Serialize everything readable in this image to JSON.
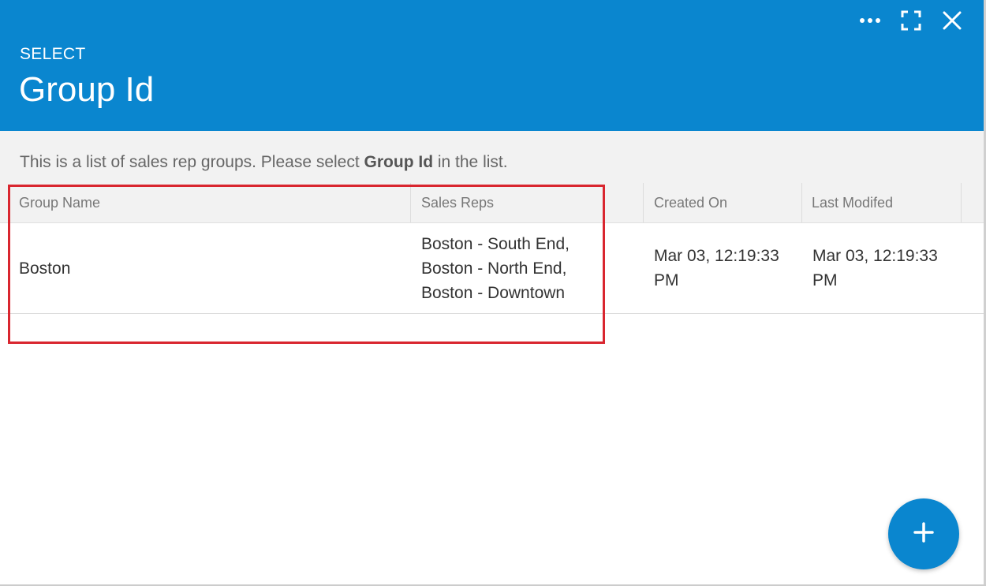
{
  "header": {
    "subtitle": "SELECT",
    "title": "Group Id",
    "bg_color": "#0a86cf",
    "buttons": [
      "more-icon",
      "maximize-icon",
      "close-icon"
    ]
  },
  "info": {
    "prefix": "This is a list of sales rep groups. Please select ",
    "bold": "Group Id",
    "suffix": " in the list."
  },
  "table": {
    "columns": [
      "Group Name",
      "Sales Reps",
      "Created On",
      "Last Modifed"
    ],
    "rows": [
      {
        "group_name": "Boston",
        "sales_reps": [
          "Boston - South End,",
          "Boston - North End,",
          "Boston - Downtown"
        ],
        "created_on": [
          "Mar 03, 12:19:33",
          "PM"
        ],
        "last_modified": [
          "Mar 03, 12:19:33",
          "PM"
        ]
      }
    ]
  },
  "highlight_color": "#d9262f",
  "fab": {
    "icon": "plus-icon"
  }
}
